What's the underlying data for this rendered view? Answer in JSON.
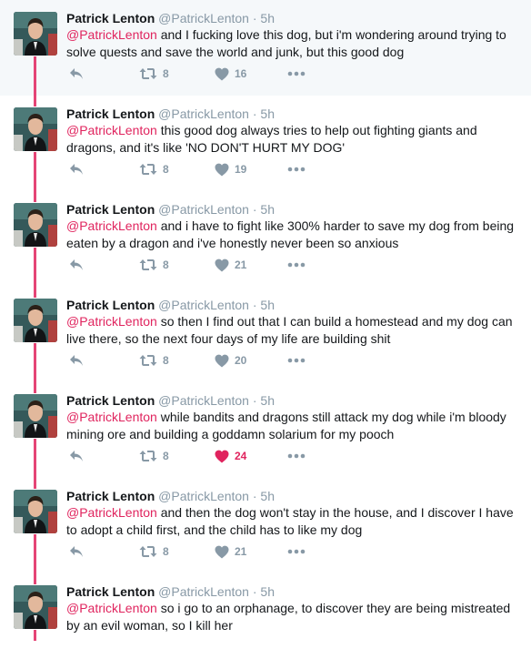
{
  "colors": {
    "accent": "#e0245e",
    "muted": "#8899a6",
    "text": "#14171a"
  },
  "tweets": [
    {
      "name": "Patrick Lenton",
      "handle": "@PatrickLenton",
      "time": "5h",
      "mention": "@PatrickLenton",
      "body": " and I fucking love this dog, but i'm wondering around trying to solve quests and save the world and junk, but this good dog",
      "retweets": "8",
      "likes": "16",
      "liked": false
    },
    {
      "name": "Patrick Lenton",
      "handle": "@PatrickLenton",
      "time": "5h",
      "mention": "@PatrickLenton",
      "body": " this good dog always tries to help out fighting giants and dragons, and it's like 'NO DON'T HURT MY DOG'",
      "retweets": "8",
      "likes": "19",
      "liked": false
    },
    {
      "name": "Patrick Lenton",
      "handle": "@PatrickLenton",
      "time": "5h",
      "mention": "@PatrickLenton",
      "body": " and i have to fight like 300% harder to save my dog from being eaten by a dragon and i've honestly never been so anxious",
      "retweets": "8",
      "likes": "21",
      "liked": false
    },
    {
      "name": "Patrick Lenton",
      "handle": "@PatrickLenton",
      "time": "5h",
      "mention": "@PatrickLenton",
      "body": " so then I find out that I can build a homestead and my dog can live there, so the next four days of my life are building shit",
      "retweets": "8",
      "likes": "20",
      "liked": false
    },
    {
      "name": "Patrick Lenton",
      "handle": "@PatrickLenton",
      "time": "5h",
      "mention": "@PatrickLenton",
      "body": " while bandits and dragons still attack my dog while i'm bloody mining ore and building a goddamn solarium for my pooch",
      "retweets": "8",
      "likes": "24",
      "liked": true
    },
    {
      "name": "Patrick Lenton",
      "handle": "@PatrickLenton",
      "time": "5h",
      "mention": "@PatrickLenton",
      "body": " and then the dog won't stay in the house, and I discover I have to adopt a child first, and the child has to like my dog",
      "retweets": "8",
      "likes": "21",
      "liked": false
    },
    {
      "name": "Patrick Lenton",
      "handle": "@PatrickLenton",
      "time": "5h",
      "mention": "@PatrickLenton",
      "body": " so i go to an orphanage, to discover they are being mistreated by an evil woman, so I kill her",
      "retweets": "",
      "likes": "",
      "liked": false
    }
  ]
}
